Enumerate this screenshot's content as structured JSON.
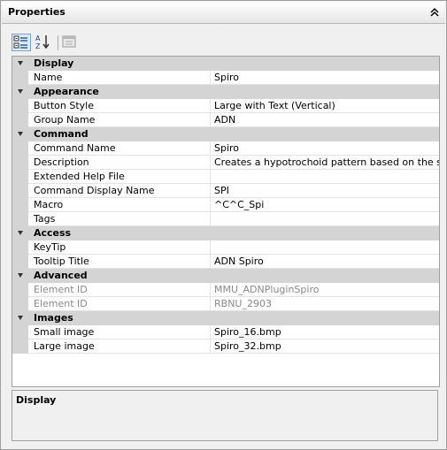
{
  "panel": {
    "title": "Properties"
  },
  "categories": [
    {
      "label": "Display",
      "props": [
        {
          "name": "Name",
          "value": "Spiro"
        }
      ]
    },
    {
      "label": "Appearance",
      "props": [
        {
          "name": "Button Style",
          "value": "Large with Text (Vertical)"
        },
        {
          "name": "Group Name",
          "value": "ADN"
        }
      ]
    },
    {
      "label": "Command",
      "props": [
        {
          "name": "Command Name",
          "value": "Spiro"
        },
        {
          "name": "Description",
          "value": "Creates a hypotrochoid pattern based on the specified"
        },
        {
          "name": "Extended Help File",
          "value": ""
        },
        {
          "name": "Command Display Name",
          "value": "SPI"
        },
        {
          "name": "Macro",
          "value": "^C^C_Spi"
        },
        {
          "name": "Tags",
          "value": ""
        }
      ]
    },
    {
      "label": "Access",
      "props": [
        {
          "name": "KeyTip",
          "value": ""
        },
        {
          "name": "Tooltip Title",
          "value": "ADN Spiro"
        }
      ]
    },
    {
      "label": "Advanced",
      "props": [
        {
          "name": "Element ID",
          "value": "MMU_ADNPluginSpiro",
          "disabled": true
        },
        {
          "name": "Element ID",
          "value": "RBNU_2903",
          "disabled": true
        }
      ]
    },
    {
      "label": "Images",
      "props": [
        {
          "name": "Small image",
          "value": "Spiro_16.bmp"
        },
        {
          "name": "Large image",
          "value": "Spiro_32.bmp"
        }
      ]
    }
  ],
  "description": {
    "title": "Display"
  }
}
